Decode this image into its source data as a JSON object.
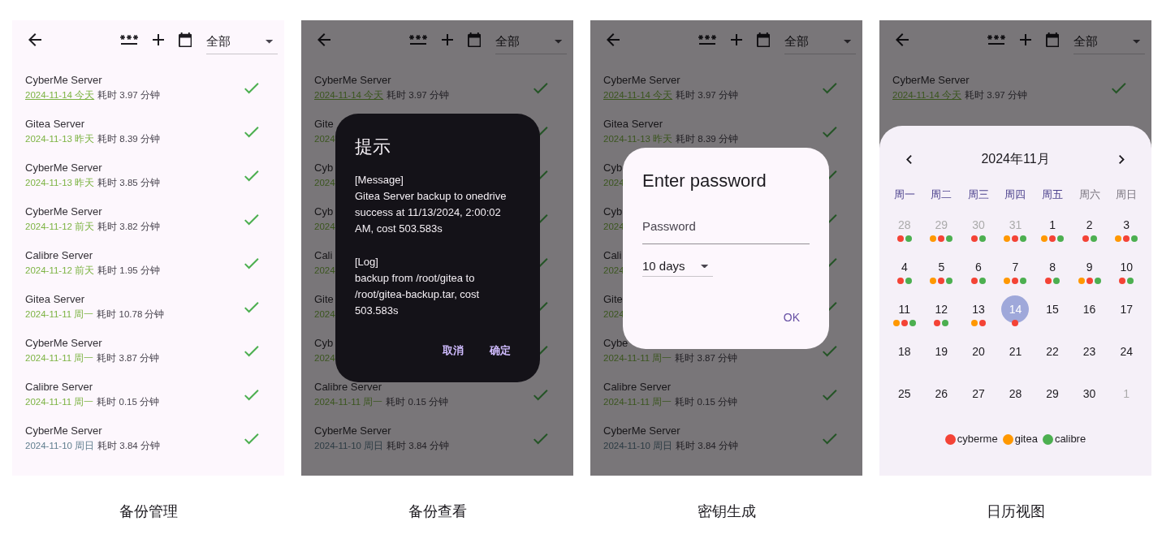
{
  "panels": [
    {
      "caption": "备份管理",
      "app_bar": {
        "filter": "全部"
      },
      "rows": [
        {
          "name": "CyberMe Server",
          "date": "2024-11-14 今天",
          "duration": "耗时 3.97 分钟",
          "recent": true,
          "today": true
        },
        {
          "name": "Gitea Server",
          "date": "2024-11-13 昨天",
          "duration": "耗时 8.39 分钟",
          "recent": true,
          "today": false
        },
        {
          "name": "CyberMe Server",
          "date": "2024-11-13 昨天",
          "duration": "耗时 3.85 分钟",
          "recent": true,
          "today": false
        },
        {
          "name": "CyberMe Server",
          "date": "2024-11-12 前天",
          "duration": "耗时 3.82 分钟",
          "recent": true,
          "today": false
        },
        {
          "name": "Calibre Server",
          "date": "2024-11-12 前天",
          "duration": "耗时 1.95 分钟",
          "recent": true,
          "today": false
        },
        {
          "name": "Gitea Server",
          "date": "2024-11-11 周一",
          "duration": "耗时 10.78 分钟",
          "recent": true,
          "today": false
        },
        {
          "name": "CyberMe Server",
          "date": "2024-11-11 周一",
          "duration": "耗时 3.87 分钟",
          "recent": true,
          "today": false
        },
        {
          "name": "Calibre Server",
          "date": "2024-11-11 周一",
          "duration": "耗时 0.15 分钟",
          "recent": true,
          "today": false
        },
        {
          "name": "CyberMe Server",
          "date": "2024-11-10 周日",
          "duration": "耗时 3.84 分钟",
          "recent": false,
          "today": false
        }
      ]
    },
    {
      "caption": "备份查看",
      "app_bar": {
        "filter": "全部"
      },
      "rows": [
        {
          "name": "CyberMe Server",
          "date": "2024-11-14 今天",
          "duration": "耗时 3.97 分钟",
          "recent": true,
          "today": true
        },
        {
          "name": "Gite",
          "date": "2024",
          "recent": true,
          "today": false
        },
        {
          "name": "Cyb",
          "date": "2024",
          "recent": true,
          "today": false
        },
        {
          "name": "Cyb",
          "date": "2024",
          "recent": true,
          "today": false
        },
        {
          "name": "Cali",
          "date": "2024",
          "recent": true,
          "today": false
        },
        {
          "name": "Gite",
          "date": "2024",
          "recent": true,
          "today": false
        },
        {
          "name": "Cyb",
          "date": "2024",
          "recent": true,
          "today": false
        },
        {
          "name": "Calibre Server",
          "date": "2024-11-11 周一",
          "duration": "耗时 0.15 分钟",
          "recent": true,
          "today": false
        },
        {
          "name": "CyberMe Server",
          "date": "2024-11-10 周日",
          "duration": "耗时 3.84 分钟",
          "recent": false,
          "today": false
        }
      ],
      "overlay": {
        "kind": "alert",
        "title": "提示",
        "sections": [
          {
            "heading": "[Message]",
            "text": "Gitea Server backup to onedrive success at 11/13/2024, 2:00:02 AM, cost 503.583s"
          },
          {
            "heading": "[Log]",
            "text": "backup from /root/gitea to /root/gitea-backup.tar, cost 503.583s"
          }
        ],
        "buttons": [
          "取消",
          "确定"
        ]
      }
    },
    {
      "caption": "密钥生成",
      "app_bar": {
        "filter": "全部"
      },
      "rows": [
        {
          "name": "CyberMe Server",
          "date": "2024-11-14 今天",
          "duration": "耗时 3.97 分钟",
          "recent": true,
          "today": true
        },
        {
          "name": "Gitea Server",
          "date": "2024-11-13 昨天",
          "duration": "耗时 8.39 分钟",
          "recent": true,
          "today": false
        },
        {
          "name": "Cyb",
          "date": "2024",
          "recent": true,
          "today": false
        },
        {
          "name": "Cyb",
          "date": "2024",
          "recent": true,
          "today": false
        },
        {
          "name": "Cali",
          "date": "2024",
          "recent": true,
          "today": false
        },
        {
          "name": "Gite",
          "date": "2024",
          "recent": true,
          "today": false
        },
        {
          "name": "Cybe",
          "date": "2024-11-11 周一",
          "duration": "耗时 3.87 分钟",
          "recent": true,
          "today": false
        },
        {
          "name": "Calibre Server",
          "date": "2024-11-11 周一",
          "duration": "耗时 0.15 分钟",
          "recent": true,
          "today": false
        },
        {
          "name": "CyberMe Server",
          "date": "2024-11-10 周日",
          "duration": "耗时 3.84 分钟",
          "recent": false,
          "today": false
        }
      ],
      "overlay": {
        "kind": "password",
        "title": "Enter password",
        "field": {
          "placeholder": "Password"
        },
        "select": {
          "value": "10 days"
        },
        "buttons": [
          "OK"
        ]
      }
    },
    {
      "caption": "日历视图",
      "app_bar": {
        "filter": "全部"
      },
      "rows": [
        {
          "name": "CyberMe Server",
          "date": "2024-11-14 今天",
          "duration": "耗时 3.97 分钟",
          "recent": true,
          "today": true
        }
      ],
      "overlay": {
        "kind": "calendar",
        "month": "2024年11月",
        "weekdays": [
          {
            "label": "周一",
            "weekend": false
          },
          {
            "label": "周二",
            "weekend": false
          },
          {
            "label": "周三",
            "weekend": false
          },
          {
            "label": "周四",
            "weekend": false
          },
          {
            "label": "周五",
            "weekend": false
          },
          {
            "label": "周六",
            "weekend": true
          },
          {
            "label": "周日",
            "weekend": true
          }
        ],
        "days": [
          {
            "label": "28",
            "outside": true,
            "selected": false,
            "dots": [
              {
                "color": "#f44336"
              },
              {
                "color": "#4caf50"
              }
            ]
          },
          {
            "label": "29",
            "outside": true,
            "selected": false,
            "dots": [
              {
                "color": "#ff9800"
              },
              {
                "color": "#f44336"
              },
              {
                "color": "#4caf50"
              }
            ]
          },
          {
            "label": "30",
            "outside": true,
            "selected": false,
            "dots": [
              {
                "color": "#f44336"
              },
              {
                "color": "#4caf50"
              }
            ]
          },
          {
            "label": "31",
            "outside": true,
            "selected": false,
            "dots": [
              {
                "color": "#ff9800"
              },
              {
                "color": "#f44336"
              },
              {
                "color": "#4caf50"
              }
            ]
          },
          {
            "label": "1",
            "outside": false,
            "selected": false,
            "dots": [
              {
                "color": "#ff9800"
              },
              {
                "color": "#f44336"
              },
              {
                "color": "#4caf50"
              }
            ]
          },
          {
            "label": "2",
            "outside": false,
            "selected": false,
            "dots": [
              {
                "color": "#f44336"
              },
              {
                "color": "#4caf50"
              }
            ]
          },
          {
            "label": "3",
            "outside": false,
            "selected": false,
            "dots": [
              {
                "color": "#ff9800"
              },
              {
                "color": "#f44336"
              },
              {
                "color": "#4caf50"
              }
            ]
          },
          {
            "label": "4",
            "outside": false,
            "selected": false,
            "dots": [
              {
                "color": "#f44336"
              },
              {
                "color": "#4caf50"
              }
            ]
          },
          {
            "label": "5",
            "outside": false,
            "selected": false,
            "dots": [
              {
                "color": "#ff9800"
              },
              {
                "color": "#f44336"
              },
              {
                "color": "#4caf50"
              }
            ]
          },
          {
            "label": "6",
            "outside": false,
            "selected": false,
            "dots": [
              {
                "color": "#f44336"
              },
              {
                "color": "#4caf50"
              }
            ]
          },
          {
            "label": "7",
            "outside": false,
            "selected": false,
            "dots": [
              {
                "color": "#ff9800"
              },
              {
                "color": "#f44336"
              },
              {
                "color": "#4caf50"
              }
            ]
          },
          {
            "label": "8",
            "outside": false,
            "selected": false,
            "dots": [
              {
                "color": "#f44336"
              },
              {
                "color": "#4caf50"
              }
            ]
          },
          {
            "label": "9",
            "outside": false,
            "selected": false,
            "dots": [
              {
                "color": "#ff9800"
              },
              {
                "color": "#f44336"
              },
              {
                "color": "#4caf50"
              }
            ]
          },
          {
            "label": "10",
            "outside": false,
            "selected": false,
            "dots": [
              {
                "color": "#f44336"
              },
              {
                "color": "#4caf50"
              }
            ]
          },
          {
            "label": "11",
            "outside": false,
            "selected": false,
            "dots": [
              {
                "color": "#ff9800"
              },
              {
                "color": "#f44336"
              },
              {
                "color": "#4caf50"
              }
            ]
          },
          {
            "label": "12",
            "outside": false,
            "selected": false,
            "dots": [
              {
                "color": "#f44336"
              },
              {
                "color": "#4caf50"
              }
            ]
          },
          {
            "label": "13",
            "outside": false,
            "selected": false,
            "dots": [
              {
                "color": "#ff9800"
              },
              {
                "color": "#f44336"
              }
            ]
          },
          {
            "label": "14",
            "outside": false,
            "selected": true,
            "dots": [
              {
                "color": "#f44336"
              }
            ]
          },
          {
            "label": "15",
            "outside": false,
            "selected": false
          },
          {
            "label": "16",
            "outside": false,
            "selected": false
          },
          {
            "label": "17",
            "outside": false,
            "selected": false
          },
          {
            "label": "18",
            "outside": false,
            "selected": false
          },
          {
            "label": "19",
            "outside": false,
            "selected": false
          },
          {
            "label": "20",
            "outside": false,
            "selected": false
          },
          {
            "label": "21",
            "outside": false,
            "selected": false
          },
          {
            "label": "22",
            "outside": false,
            "selected": false
          },
          {
            "label": "23",
            "outside": false,
            "selected": false
          },
          {
            "label": "24",
            "outside": false,
            "selected": false
          },
          {
            "label": "25",
            "outside": false,
            "selected": false
          },
          {
            "label": "26",
            "outside": false,
            "selected": false
          },
          {
            "label": "27",
            "outside": false,
            "selected": false
          },
          {
            "label": "28",
            "outside": false,
            "selected": false
          },
          {
            "label": "29",
            "outside": false,
            "selected": false
          },
          {
            "label": "30",
            "outside": false,
            "selected": false
          },
          {
            "label": "1",
            "outside": true,
            "selected": false
          }
        ],
        "legend": [
          {
            "label": "cyberme",
            "color": "#f44336"
          },
          {
            "label": "gitea",
            "color": "#ff9800"
          },
          {
            "label": "calibre",
            "color": "#4caf50"
          }
        ]
      }
    }
  ]
}
